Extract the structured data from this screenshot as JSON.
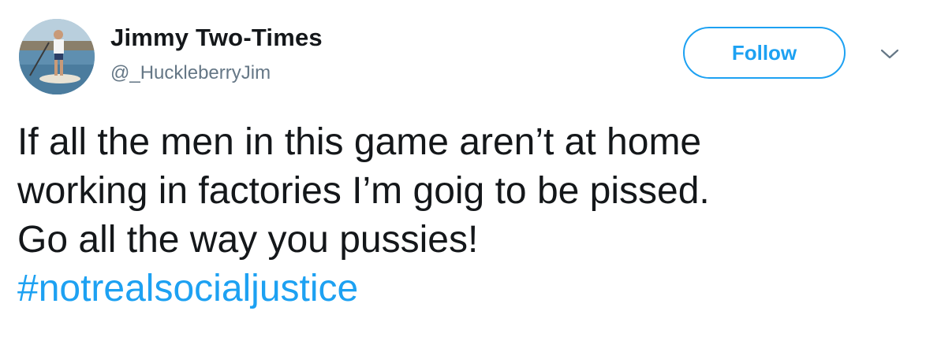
{
  "tweet": {
    "author": {
      "display_name": "Jimmy Two-Times",
      "username": "@_HuckleberryJim"
    },
    "follow_label": "Follow",
    "text_lines": [
      "If all the men in this game aren’t at home",
      "working in factories I’m goig to be pissed.",
      "Go all the way you pussies!"
    ],
    "hashtag": "#notrealsocialjustice"
  },
  "colors": {
    "accent": "#1da1f2",
    "text": "#14171a",
    "muted": "#657786"
  },
  "icons": {
    "menu": "chevron-down-icon"
  }
}
